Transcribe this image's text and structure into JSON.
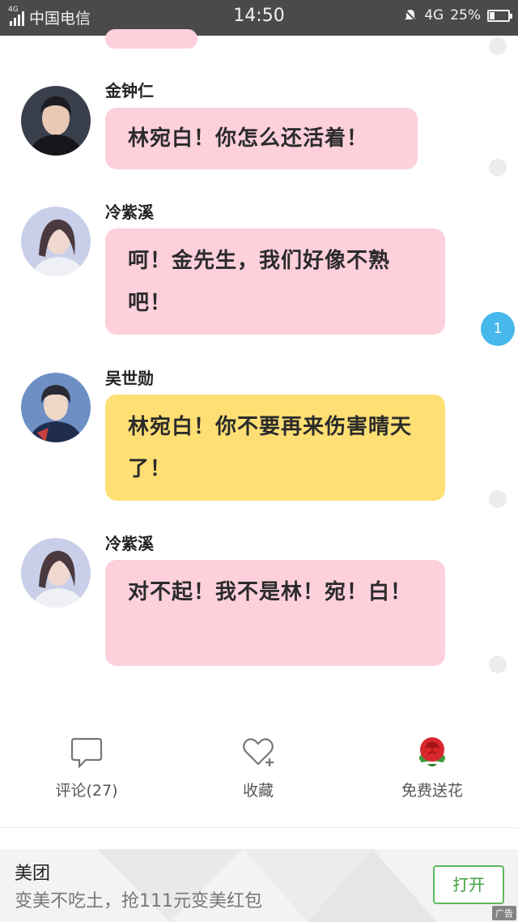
{
  "status_bar": {
    "network_tag": "4G",
    "carrier": "中国电信",
    "time": "14:50",
    "network": "4G",
    "battery": "25%",
    "battery_level": 0.25
  },
  "messages": [
    {
      "sender": "金钟仁",
      "text": "林宛白！你怎么还活着！",
      "bubble_color": "#fdd0dc"
    },
    {
      "sender": "冷紫溪",
      "text": "呵！金先生，我们好像不熟吧！",
      "bubble_color": "#fdd0dc"
    },
    {
      "sender": "吴世勋",
      "text": "林宛白！你不要再来伤害晴天了！",
      "bubble_color": "#fddf74"
    },
    {
      "sender": "冷紫溪",
      "text": "对不起！我不是林！宛！白！",
      "bubble_color": "#fdd0dc"
    }
  ],
  "side_badge": "1",
  "actions": {
    "comment_label": "评论(27)",
    "favorite_label": "收藏",
    "flower_label": "免费送花"
  },
  "ad": {
    "title": "美团",
    "description": "变美不吃土，抢111元变美红包",
    "button_label": "打开",
    "tag": "广告"
  },
  "icons": {
    "comment": "speech-bubble-icon",
    "favorite": "heart-plus-icon",
    "flower": "rose-icon"
  },
  "colors": {
    "pink_bubble": "#fdd0dc",
    "yellow_bubble": "#fddf74",
    "badge": "#46b8ec",
    "ad_button": "#3ea13e"
  }
}
